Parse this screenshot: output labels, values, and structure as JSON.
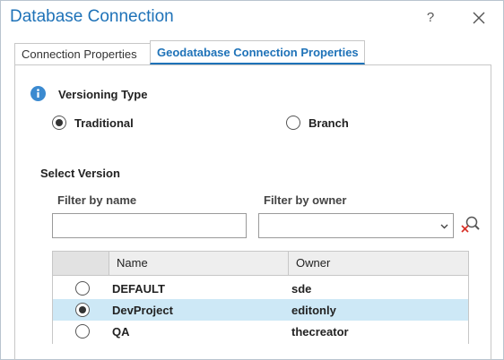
{
  "window": {
    "title": "Database Connection",
    "help_label": "?"
  },
  "tabs": [
    {
      "label": "Connection Properties",
      "active": false
    },
    {
      "label": "Geodatabase Connection Properties",
      "active": true
    }
  ],
  "versioning": {
    "heading": "Versioning Type",
    "options": [
      {
        "label": "Traditional",
        "checked": true
      },
      {
        "label": "Branch",
        "checked": false
      }
    ]
  },
  "select_version": {
    "heading": "Select Version",
    "filter_name": {
      "label": "Filter by name",
      "value": "",
      "placeholder": ""
    },
    "filter_owner": {
      "label": "Filter by owner",
      "value": ""
    },
    "columns": [
      "Name",
      "Owner"
    ],
    "rows": [
      {
        "name": "DEFAULT",
        "owner": "sde",
        "selected": false
      },
      {
        "name": "DevProject",
        "owner": "editonly",
        "selected": true
      },
      {
        "name": "QA",
        "owner": "thecreator",
        "selected": false
      }
    ]
  },
  "colors": {
    "accent": "#1e72b8",
    "selected_row": "#cde8f6",
    "clear_icon_red": "#d9342b"
  },
  "icons": {
    "info": "info-icon",
    "close": "close-icon",
    "dropdown": "chevron-down-icon",
    "clear_search": "clear-search-icon"
  }
}
